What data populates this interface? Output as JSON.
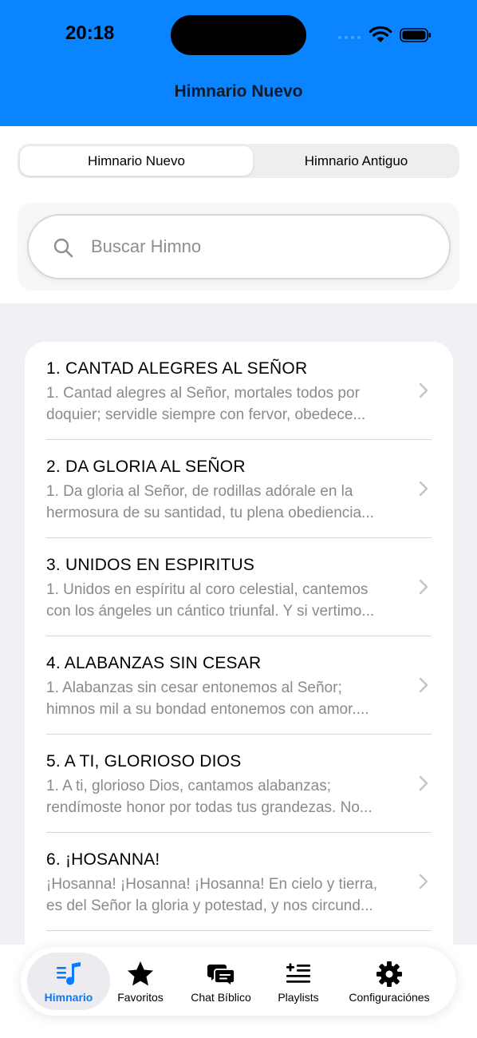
{
  "status_bar": {
    "time": "20:18"
  },
  "nav": {
    "title": "Himnario Nuevo"
  },
  "segments": {
    "active": "Himnario Nuevo",
    "inactive": "Himnario Antiguo"
  },
  "search": {
    "placeholder": "Buscar Himno",
    "value": ""
  },
  "hymns": [
    {
      "title": "1. CANTAD ALEGRES AL SEÑOR",
      "line1": "1. Cantad alegres al Señor, mortales todos por",
      "line2": "doquier; servidle siempre con fervor, obedece..."
    },
    {
      "title": "2. DA GLORIA AL SEÑOR",
      "line1": "1. Da gloria al Señor, de rodillas adórale en la",
      "line2": "hermosura de su santidad, tu plena obediencia..."
    },
    {
      "title": "3. UNIDOS EN ESPIRITUS",
      "line1": "1. Unidos en espíritu al coro celestial, cantemos",
      "line2": "con los ángeles un cántico triunfal. Y si vertimo..."
    },
    {
      "title": "4. ALABANZAS SIN CESAR",
      "line1": "1. Alabanzas sin cesar entonemos al Señor;",
      "line2": "himnos mil a su bondad entonemos con amor...."
    },
    {
      "title": "5. A TI, GLORIOSO DIOS",
      "line1": "1. A ti, glorioso Dios, cantamos alabanzas;",
      "line2": "rendímoste honor por todas tus grandezas. No..."
    },
    {
      "title": "6. ¡HOSANNA!",
      "line1": "¡Hosanna! ¡Hosanna! ¡Hosanna! En cielo y tierra,",
      "line2": "es del Señor la gloria y potestad, y nos circund..."
    }
  ],
  "tabs": [
    {
      "label": "Himnario",
      "icon": "music-note-list-icon",
      "active": true
    },
    {
      "label": "Favoritos",
      "icon": "star-icon"
    },
    {
      "label": "Chat Bíblico",
      "icon": "chat-bubbles-icon"
    },
    {
      "label": "Playlists",
      "icon": "playlist-add-icon"
    },
    {
      "label": "Configuraciónes",
      "icon": "gear-icon"
    }
  ],
  "colors": {
    "accent": "#0a84ff",
    "tab_active": "#0a7aff",
    "subtitle": "#8a8a8e"
  }
}
